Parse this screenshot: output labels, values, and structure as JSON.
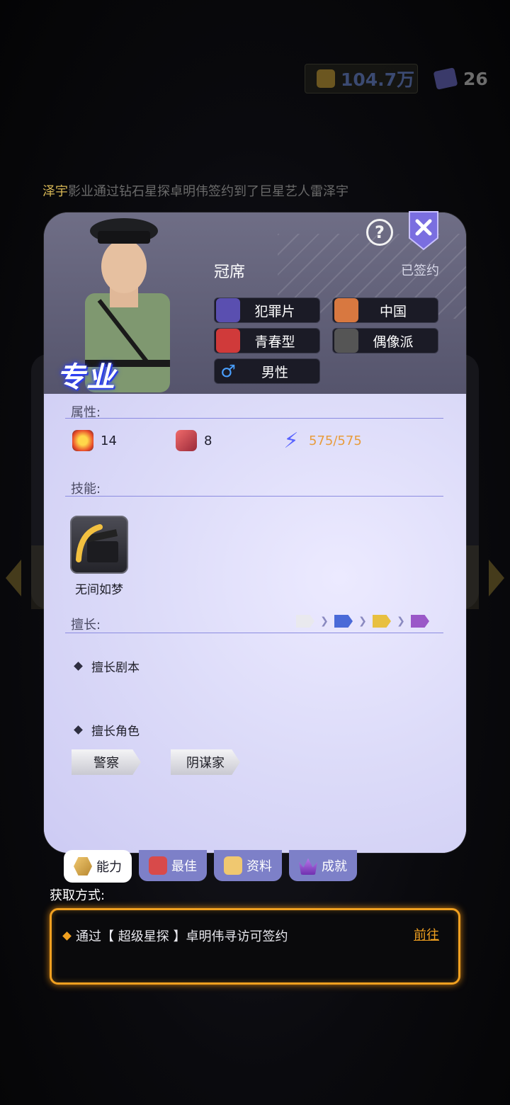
{
  "header": {
    "currency_value": "104.7万",
    "book_count": "26"
  },
  "ticker": {
    "highlight_name": "泽宇",
    "message": "影业通过钻石星探卓明伟签约到了巨星艺人雷泽宇"
  },
  "card": {
    "rank": "冠席",
    "status": "已签约",
    "badge": "专业",
    "tags": [
      {
        "icon": "film-reel-icon",
        "label": "犯罪片"
      },
      {
        "icon": "china-scroll-icon",
        "label": "中国"
      },
      {
        "icon": "bowtie-icon",
        "label": "青春型"
      },
      {
        "icon": "microphone-icon",
        "label": "偶像派"
      },
      {
        "icon": "male-symbol-icon",
        "label": "男性"
      }
    ],
    "attributes_label": "属性:",
    "attributes": [
      {
        "icon": "explosion-icon",
        "value": "14"
      },
      {
        "icon": "drama-mask-icon",
        "value": "8"
      },
      {
        "icon": "lightning-icon",
        "value": "575/575"
      }
    ],
    "skills_label": "技能:",
    "skill_name": "无间如梦",
    "specialty_label": "擅长:",
    "specialty_script": "擅长剧本",
    "specialty_role": "擅长角色",
    "roles": [
      "警察",
      "阴谋家"
    ],
    "grade_colors": [
      "#e9e9ee",
      "#4a6ad8",
      "#e8c040",
      "#9a58c8"
    ]
  },
  "tabs": [
    {
      "label": "能力",
      "active": true
    },
    {
      "label": "最佳",
      "active": false
    },
    {
      "label": "资料",
      "active": false
    },
    {
      "label": "成就",
      "active": false
    }
  ],
  "obtain": {
    "title": "获取方式:",
    "text": "通过【 超级星探 】卓明伟寻访可签约",
    "goto_label": "前往"
  },
  "colors": {
    "accent_orange": "#f0a020",
    "energy": "#e89c3c",
    "badge_blue": "#2a3cff"
  }
}
